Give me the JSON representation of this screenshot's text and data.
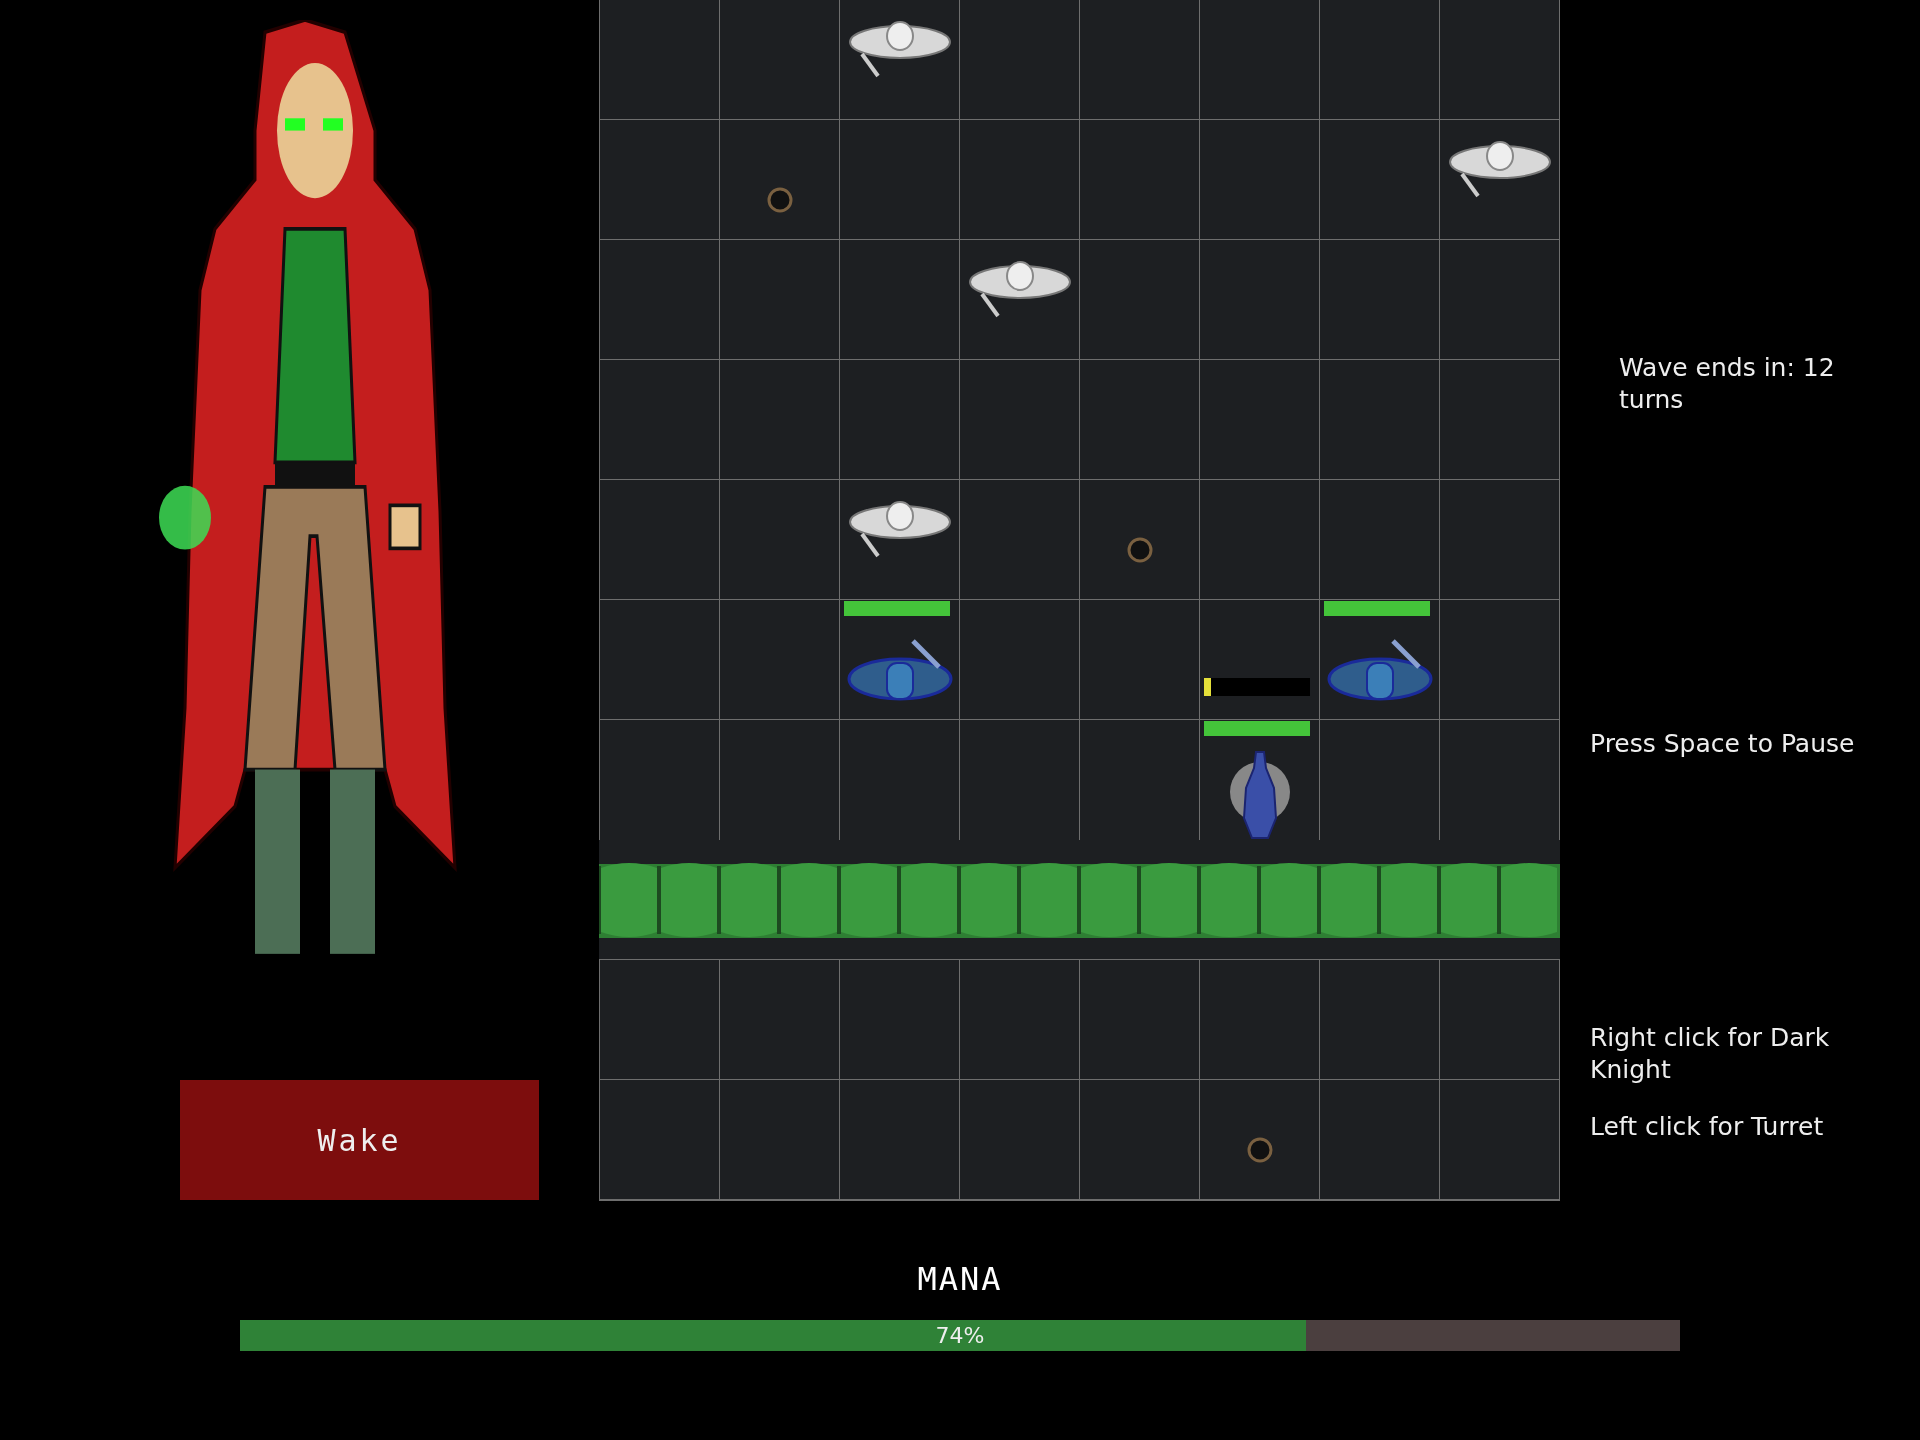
{
  "wake_button": {
    "label": "Wake"
  },
  "board": {
    "rows": [
      {
        "kind": "tiles",
        "cells": [
          {
            "kind": "empty"
          },
          {
            "kind": "empty"
          },
          {
            "kind": "enemy"
          },
          {
            "kind": "empty"
          },
          {
            "kind": "empty"
          },
          {
            "kind": "empty"
          },
          {
            "kind": "empty"
          },
          {
            "kind": "empty"
          }
        ]
      },
      {
        "kind": "tiles",
        "cells": [
          {
            "kind": "empty"
          },
          {
            "kind": "mine"
          },
          {
            "kind": "empty"
          },
          {
            "kind": "empty"
          },
          {
            "kind": "empty"
          },
          {
            "kind": "empty"
          },
          {
            "kind": "empty"
          },
          {
            "kind": "enemy"
          }
        ]
      },
      {
        "kind": "tiles",
        "cells": [
          {
            "kind": "empty"
          },
          {
            "kind": "empty"
          },
          {
            "kind": "empty"
          },
          {
            "kind": "enemy"
          },
          {
            "kind": "empty"
          },
          {
            "kind": "empty"
          },
          {
            "kind": "empty"
          },
          {
            "kind": "empty"
          }
        ]
      },
      {
        "kind": "tiles",
        "cells": [
          {
            "kind": "empty"
          },
          {
            "kind": "empty"
          },
          {
            "kind": "empty"
          },
          {
            "kind": "empty"
          },
          {
            "kind": "empty"
          },
          {
            "kind": "empty"
          },
          {
            "kind": "empty"
          },
          {
            "kind": "empty"
          }
        ]
      },
      {
        "kind": "tiles",
        "cells": [
          {
            "kind": "empty"
          },
          {
            "kind": "empty"
          },
          {
            "kind": "enemy"
          },
          {
            "kind": "empty"
          },
          {
            "kind": "mine"
          },
          {
            "kind": "empty"
          },
          {
            "kind": "empty"
          },
          {
            "kind": "empty"
          }
        ]
      },
      {
        "kind": "tiles",
        "cells": [
          {
            "kind": "empty"
          },
          {
            "kind": "empty"
          },
          {
            "kind": "turret",
            "health": {
              "level": 1
            }
          },
          {
            "kind": "empty"
          },
          {
            "kind": "empty"
          },
          {
            "kind": "empty"
          },
          {
            "kind": "turret",
            "health": {
              "level": 1
            }
          },
          {
            "kind": "empty"
          }
        ]
      },
      {
        "kind": "tiles",
        "cells": [
          {
            "kind": "empty"
          },
          {
            "kind": "empty"
          },
          {
            "kind": "empty"
          },
          {
            "kind": "empty"
          },
          {
            "kind": "empty"
          },
          {
            "kind": "knight",
            "health": {
              "level": 1
            },
            "charge": {
              "level": 0.07
            }
          },
          {
            "kind": "empty"
          },
          {
            "kind": "empty"
          }
        ]
      },
      {
        "kind": "hedge"
      },
      {
        "kind": "tiles",
        "cells": [
          {
            "kind": "empty"
          },
          {
            "kind": "empty"
          },
          {
            "kind": "empty"
          },
          {
            "kind": "empty"
          },
          {
            "kind": "empty"
          },
          {
            "kind": "empty"
          },
          {
            "kind": "empty"
          },
          {
            "kind": "empty"
          }
        ]
      },
      {
        "kind": "tiles",
        "cells": [
          {
            "kind": "empty"
          },
          {
            "kind": "empty"
          },
          {
            "kind": "empty"
          },
          {
            "kind": "empty"
          },
          {
            "kind": "empty"
          },
          {
            "kind": "mine"
          },
          {
            "kind": "empty"
          },
          {
            "kind": "empty"
          }
        ]
      }
    ]
  },
  "wave_text": "Wave ends in: 12 turns",
  "pause_hint": "Press Space to Pause",
  "right_click_hint": "Right click for Dark Knight",
  "left_click_hint": "Left click for Turret",
  "mana": {
    "label": "MANA",
    "level": 0.74,
    "reading": "74%"
  }
}
